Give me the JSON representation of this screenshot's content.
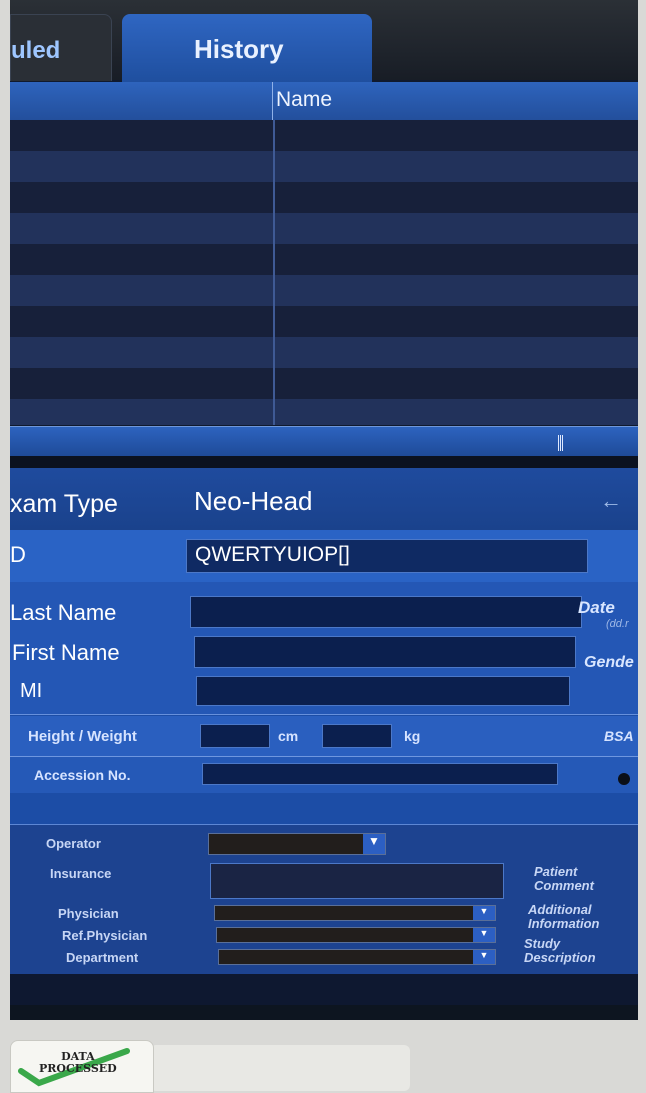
{
  "tabs": {
    "scheduled": "uled",
    "history": "History"
  },
  "grid": {
    "columns": [
      "Name"
    ]
  },
  "form": {
    "exam_type_label": "xam Type",
    "exam_type_value": "Neo-Head",
    "id_label": "D",
    "id_value": "QWERTYUIOP[]",
    "last_name_label": "Last Name",
    "first_name_label": "First Name",
    "mi_label": "MI",
    "date_label": "Date",
    "date_format": "(dd.r",
    "gender_label": "Gende",
    "height_weight_label": "Height / Weight",
    "height_unit": "cm",
    "weight_unit": "kg",
    "bsa_label": "BSA",
    "accession_label": "Accession No.",
    "operator_label": "Operator",
    "insurance_label": "Insurance",
    "physician_label": "Physician",
    "ref_physician_label": "Ref.Physician",
    "department_label": "Department",
    "patient_comment_label": "Patient Comment",
    "additional_info_label": "Additional Information",
    "study_description_label": "Study Description"
  },
  "sticker": {
    "line1": "DATA",
    "line2": "PROCESSED"
  },
  "icons": {
    "back": "arrow-left-icon",
    "dropdown": "chevron-down-icon"
  }
}
